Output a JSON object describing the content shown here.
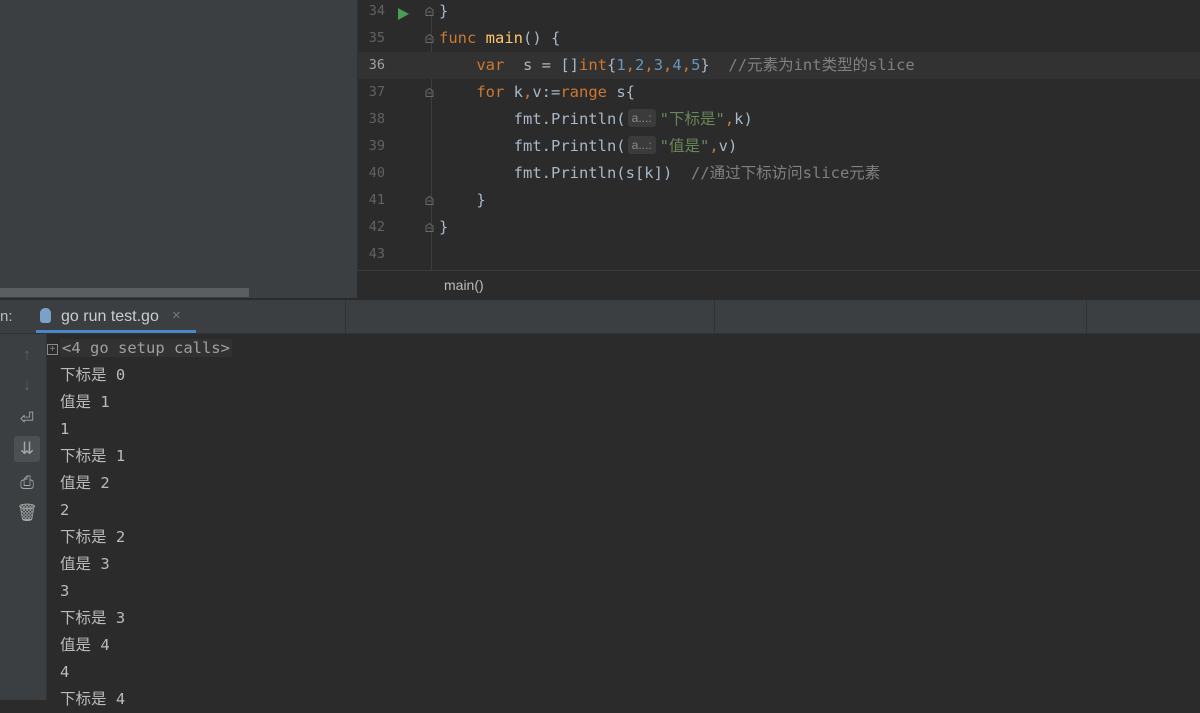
{
  "editor": {
    "current_line_index": 2,
    "lines": [
      {
        "num": "34",
        "parts": [
          {
            "t": "}",
            "c": "plain"
          }
        ]
      },
      {
        "num": "35",
        "parts": [
          {
            "t": "func ",
            "c": "kw"
          },
          {
            "t": "main",
            "c": "fn"
          },
          {
            "t": "() {",
            "c": "plain"
          }
        ]
      },
      {
        "num": "36",
        "parts": [
          {
            "t": "    ",
            "c": "plain"
          },
          {
            "t": "var",
            "c": "kw"
          },
          {
            "t": "  s = []",
            "c": "plain"
          },
          {
            "t": "int",
            "c": "kw"
          },
          {
            "t": "{",
            "c": "plain"
          },
          {
            "t": "1",
            "c": "num"
          },
          {
            "t": ",",
            "c": "kw"
          },
          {
            "t": "2",
            "c": "num"
          },
          {
            "t": ",",
            "c": "kw"
          },
          {
            "t": "3",
            "c": "num"
          },
          {
            "t": ",",
            "c": "kw"
          },
          {
            "t": "4",
            "c": "num"
          },
          {
            "t": ",",
            "c": "kw"
          },
          {
            "t": "5",
            "c": "num"
          },
          {
            "t": "}  ",
            "c": "plain"
          },
          {
            "t": "//元素为int类型的slice",
            "c": "cmt"
          }
        ]
      },
      {
        "num": "37",
        "parts": [
          {
            "t": "    ",
            "c": "plain"
          },
          {
            "t": "for ",
            "c": "kw"
          },
          {
            "t": "k",
            "c": "plain"
          },
          {
            "t": ",",
            "c": "kw"
          },
          {
            "t": "v:=",
            "c": "plain"
          },
          {
            "t": "range ",
            "c": "kw"
          },
          {
            "t": "s{",
            "c": "plain"
          }
        ]
      },
      {
        "num": "38",
        "parts": [
          {
            "t": "        fmt.Println(",
            "c": "plain"
          },
          {
            "t": "a...:",
            "c": "hint"
          },
          {
            "t": "\"下标是\"",
            "c": "str"
          },
          {
            "t": ",",
            "c": "kw"
          },
          {
            "t": "k)",
            "c": "plain"
          }
        ]
      },
      {
        "num": "39",
        "parts": [
          {
            "t": "        fmt.Println(",
            "c": "plain"
          },
          {
            "t": "a...:",
            "c": "hint"
          },
          {
            "t": "\"值是\"",
            "c": "str"
          },
          {
            "t": ",",
            "c": "kw"
          },
          {
            "t": "v)",
            "c": "plain"
          }
        ]
      },
      {
        "num": "40",
        "parts": [
          {
            "t": "        fmt.Println(s[k])  ",
            "c": "plain"
          },
          {
            "t": "//通过下标访问slice元素",
            "c": "cmt"
          }
        ]
      },
      {
        "num": "41",
        "parts": [
          {
            "t": "    }",
            "c": "plain"
          }
        ]
      },
      {
        "num": "42",
        "parts": [
          {
            "t": "}",
            "c": "plain"
          }
        ]
      },
      {
        "num": "43",
        "parts": []
      }
    ],
    "breadcrumb": "main()"
  },
  "run_panel": {
    "label": "n:",
    "tab_label": "go run test.go",
    "close_glyph": "×",
    "toolbar": [
      {
        "name": "up-arrow-icon",
        "glyph": "↑",
        "state": "dim"
      },
      {
        "name": "down-arrow-icon",
        "glyph": "↓",
        "state": "dim"
      },
      {
        "name": "soft-wrap-icon",
        "glyph": "⏎",
        "state": "normal"
      },
      {
        "name": "scroll-to-end-icon",
        "glyph": "⇊",
        "state": "active"
      },
      {
        "name": "print-icon",
        "glyph": "⎙",
        "state": "normal"
      },
      {
        "name": "trash-icon",
        "glyph": "🗑",
        "state": "normal"
      }
    ],
    "console_lines": [
      "<4 go setup calls>",
      "下标是 0",
      "值是 1",
      "1",
      "下标是 1",
      "值是 2",
      "2",
      "下标是 2",
      "值是 3",
      "3",
      "下标是 3",
      "值是 4",
      "4",
      "下标是 4"
    ]
  },
  "colors": {
    "keyword": "#cc7832",
    "function": "#ffc66d",
    "number": "#6897bb",
    "string": "#6a8759",
    "comment": "#808080",
    "run_icon": "#499c54",
    "tab_underline": "#4a88c7"
  }
}
